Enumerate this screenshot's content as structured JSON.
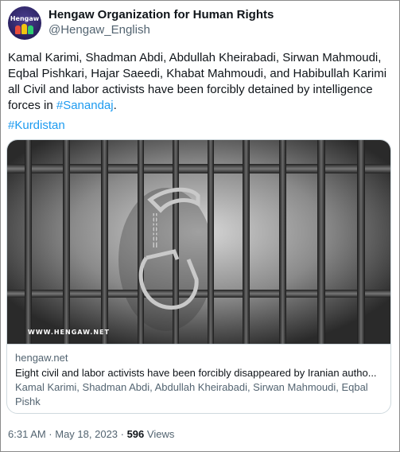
{
  "author": {
    "display_name": "Hengaw Organization for Human Rights",
    "handle": "@Hengaw_English",
    "avatar_text": "Hengaw"
  },
  "tweet": {
    "text_main": "Kamal Karimi, Shadman Abdi, Abdullah Kheirabadi, Sirwan Mahmoudi, Eqbal Pishkari, Hajar Saeedi, Khabat Mahmoudi, and Habibullah Karimi all Civil and labor activists have been forcibly detained by intelligence forces in ",
    "link_text": "#Sanandaj",
    "text_end": ".",
    "hashtag": "#Kurdistan"
  },
  "card": {
    "image_watermark": "WWW.HENGAW.NET",
    "domain": "hengaw.net",
    "title": "Eight civil and labor activists have been forcibly disappeared by Iranian autho...",
    "description": "Kamal Karimi, Shadman Abdi, Abdullah Kheirabadi, Sirwan Mahmoudi, Eqbal Pishk"
  },
  "meta": {
    "timestamp": "6:31 AM · May 18, 2023 · ",
    "views_count": "596",
    "views_label": " Views"
  },
  "colors": {
    "link": "#1d9bf0",
    "secondary_text": "#536471",
    "primary_text": "#0f1419"
  }
}
